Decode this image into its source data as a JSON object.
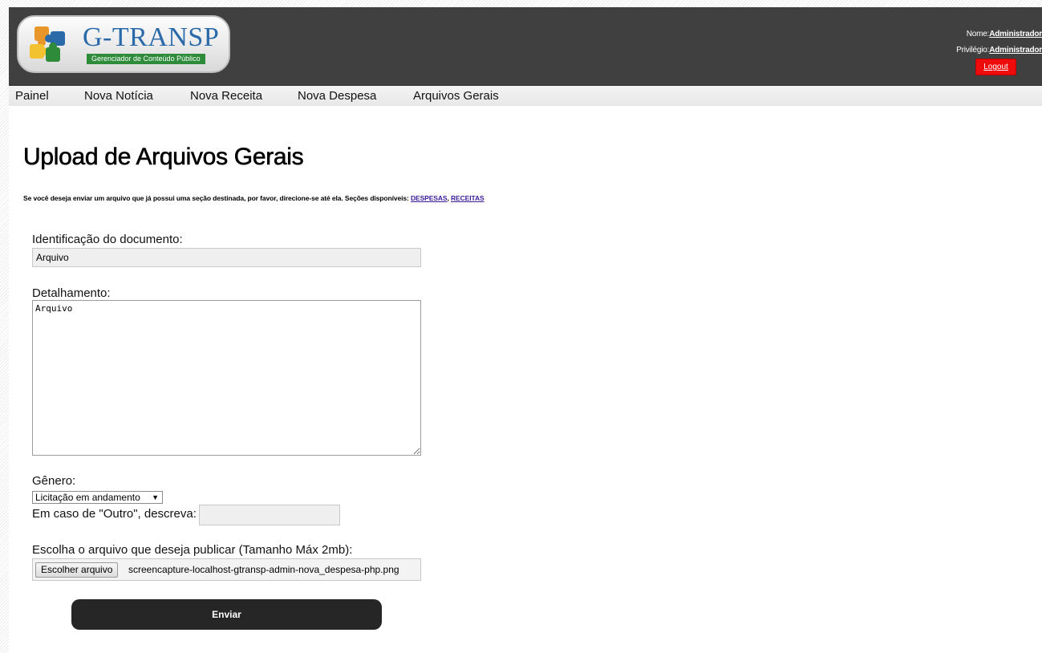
{
  "header": {
    "logo_title": "G-TRANSP",
    "logo_subtitle": "Gerenciador de Conteúdo Público",
    "name_label": "Nome:",
    "name_value": "Administrador",
    "privilege_label": "Privilégio:",
    "privilege_value": "Administrador",
    "logout_label": "Logout"
  },
  "nav": {
    "items": [
      "Painel",
      "Nova Notícia",
      "Nova Receita",
      "Nova Despesa",
      "Arquivos Gerais"
    ]
  },
  "page": {
    "title": "Upload de Arquivos Gerais",
    "info_text": "Se você deseja enviar um arquivo que já possui uma seção destinada, por favor, direcione-se até ela. Seções disponíveis: ",
    "link_despesas": "DESPESAS",
    "link_separator": ", ",
    "link_receitas": "RECEITAS"
  },
  "form": {
    "identification_label": "Identificação do documento:",
    "identification_value": "Arquivo",
    "detail_label": "Detalhamento:",
    "detail_value": "Arquivo",
    "genre_label": "Gênero:",
    "genre_selected": "Licitação em andamento",
    "other_label": "Em caso de \"Outro\", descreva:",
    "other_value": "",
    "file_label": "Escolha o arquivo que deseja publicar (Tamanho Máx 2mb):",
    "file_button": "Escolher arquivo",
    "file_name": "screencapture-localhost-gtransp-admin-nova_despesa-php.png",
    "submit_label": "Enviar"
  },
  "colors": {
    "header_bg": "#404040",
    "logout_bg": "#ee0b0b",
    "submit_bg": "#262626",
    "brand_blue": "#2a6aa8",
    "brand_green": "#2e8b3a"
  }
}
